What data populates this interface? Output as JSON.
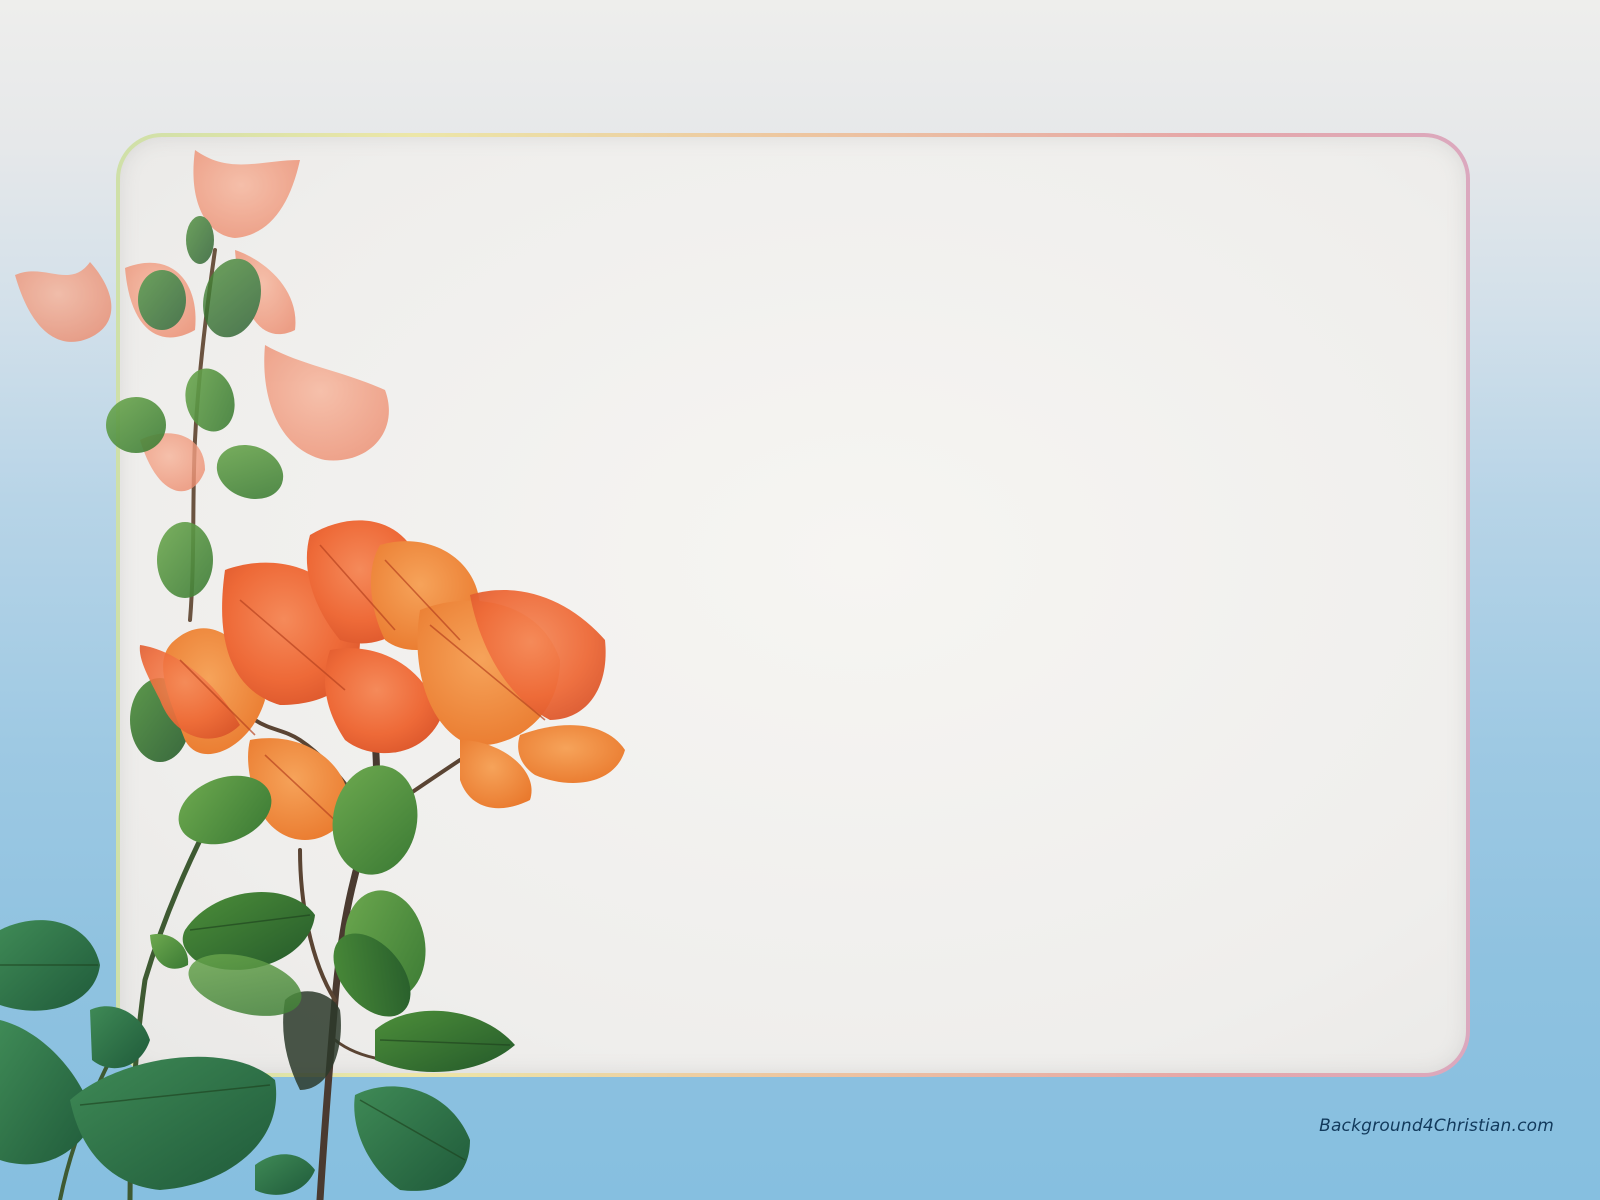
{
  "watermark": {
    "text": "Background4Christian.com"
  },
  "colors": {
    "sky_top": "#eeeeec",
    "sky_bottom": "#86bfe0",
    "frame_border_start": "#cfe0a8",
    "frame_border_end": "#dba8be",
    "panel": "#efeeec",
    "bract_orange": "#ee6a38",
    "leaf_green": "#2f6b2a",
    "watermark": "#123a5c"
  },
  "decor": {
    "plant": "bougainvillea-branch",
    "frame": "rounded-rectangle-panel"
  }
}
